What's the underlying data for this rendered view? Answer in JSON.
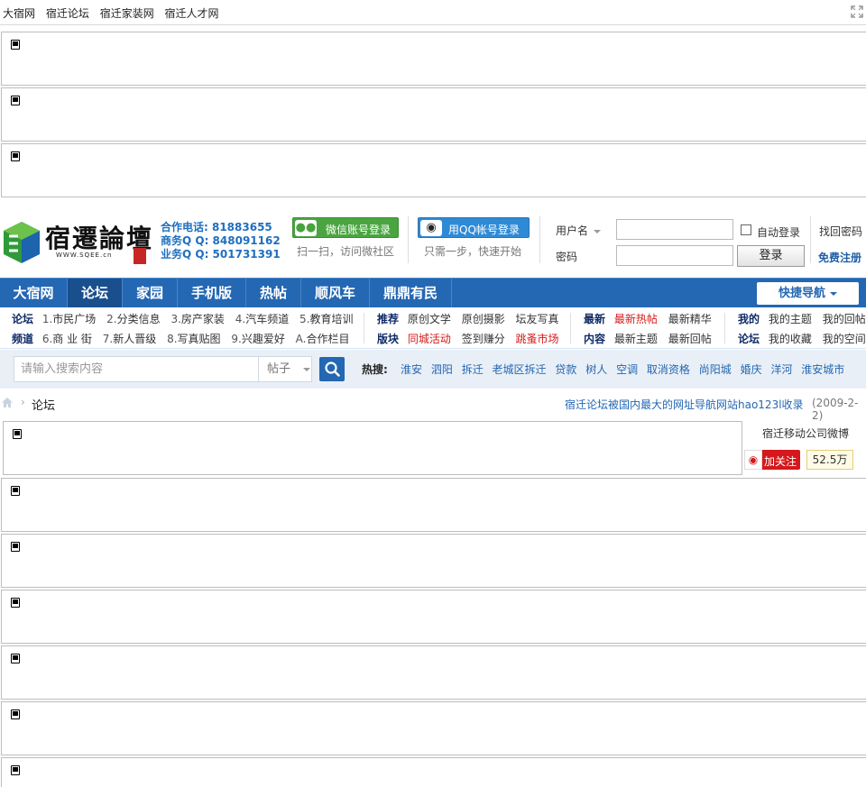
{
  "topbar": {
    "links": [
      "大宿网",
      "宿迁论坛",
      "宿迁家装网",
      "宿迁人才网"
    ],
    "expand_icon": "expand-icon"
  },
  "header": {
    "logo_title": "宿遷論壇",
    "logo_sub": "WWW.SQEE.cn",
    "contact": [
      "合作电话: 81883655",
      "商务Q Q: 848091162",
      "业务Q Q: 501731391"
    ],
    "wechat_login": "微信账号登录",
    "wechat_hint": "扫一扫，访问微社区",
    "qq_login": "用QQ帐号登录",
    "qq_hint": "只需一步，快速开始",
    "username_label": "用户名",
    "password_label": "密码",
    "auto_login": "自动登录",
    "forgot": "找回密码",
    "login": "登录",
    "register": "免费注册"
  },
  "nav": {
    "items": [
      "大宿网",
      "论坛",
      "家园",
      "手机版",
      "热帖",
      "顺风车",
      "鼎鼎有民"
    ],
    "active": "论坛",
    "quicknav": "快捷导航"
  },
  "sublinks": {
    "group1": {
      "h1": "论坛",
      "h2": "频道",
      "row1": [
        [
          "1.",
          "市民广场"
        ],
        [
          "2.",
          "分类信息"
        ],
        [
          "3.",
          "房产家装"
        ],
        [
          "4.",
          "汽车频道"
        ],
        [
          "5.",
          "教育培训"
        ]
      ],
      "row2": [
        [
          "6.",
          "商 业 街"
        ],
        [
          "7.",
          "新人晋级"
        ],
        [
          "8.",
          "写真贴图"
        ],
        [
          "9.",
          "兴趣爱好"
        ],
        [
          "A.",
          "合作栏目"
        ]
      ]
    },
    "group2": {
      "h1": "推荐",
      "h2": "版块",
      "row1": [
        "原创文学",
        "原创摄影",
        "坛友写真"
      ],
      "row2": [
        "同城活动",
        "签到赚分",
        "跳蚤市场"
      ]
    },
    "group3": {
      "h1": "最新",
      "h2": "内容",
      "row1": [
        "最新热帖",
        "最新精华"
      ],
      "row2": [
        "最新主题",
        "最新回帖"
      ]
    },
    "group4": {
      "h1": "我的",
      "h2": "论坛",
      "row1": [
        "我的主题",
        "我的回帖"
      ],
      "row2": [
        "我的收藏",
        "我的空间"
      ]
    }
  },
  "search": {
    "placeholder": "请输入搜索内容",
    "type": "帖子",
    "hot_label": "热搜:",
    "hot": [
      "淮安",
      "泗阳",
      "拆迁",
      "老城区拆迁",
      "贷款",
      "树人",
      "空调",
      "取消资格",
      "尚阳城",
      "婚庆",
      "洋河",
      "淮安城市"
    ]
  },
  "breadcrumb": {
    "current": "论坛",
    "notice": "宿迁论坛被国内最大的网址导航网站hao123l收录",
    "date": "(2009-2-2)"
  },
  "weibo": {
    "title": "宿迁移动公司微博",
    "follow": "加关注",
    "count": "52.5万"
  },
  "colors": {
    "nav": "#2467b3",
    "nav_active": "#1a4f8e",
    "wechat": "#4aa540",
    "qq": "#2f8ad6",
    "weibo": "#d5181c",
    "highlight_red": "#d61a1a"
  }
}
